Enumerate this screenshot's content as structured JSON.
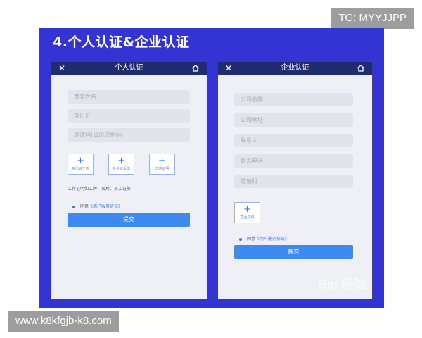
{
  "overlays": {
    "tg": "TG: MYYJJPP",
    "site": "www.k8kfgjb-k8.com"
  },
  "slide": {
    "title": "4.个人认证&企业认证",
    "watermark": "Bai 经验"
  },
  "personal": {
    "close_icon": "close-icon",
    "title": "个人认证",
    "home_icon": "home-icon",
    "fields": [
      {
        "placeholder": "真实姓名"
      },
      {
        "placeholder": "身份证"
      },
      {
        "placeholder": "邀请码(公司识别码)"
      }
    ],
    "uploads": [
      {
        "label": "身份证正面"
      },
      {
        "label": "身份证反面"
      },
      {
        "label": "工作证明"
      }
    ],
    "hint": "工作证明如工牌、名片、员工证等",
    "agree_text": "同意",
    "agree_link": "《用户服务协议》",
    "submit": "提交"
  },
  "enterprise": {
    "close_icon": "close-icon",
    "title": "企业认证",
    "home_icon": "home-icon",
    "fields": [
      {
        "placeholder": "公司名称"
      },
      {
        "placeholder": "公司地址"
      },
      {
        "placeholder": "联系人"
      },
      {
        "placeholder": "联系电话"
      },
      {
        "placeholder": "邀请码"
      }
    ],
    "uploads": [
      {
        "label": "营业执照"
      }
    ],
    "agree_text": "同意",
    "agree_link": "《用户服务协议》",
    "submit": "提交"
  },
  "colors": {
    "slide_bg": "#3434d3",
    "bar_bg": "#1f2c6e",
    "accent": "#3d8af0"
  }
}
